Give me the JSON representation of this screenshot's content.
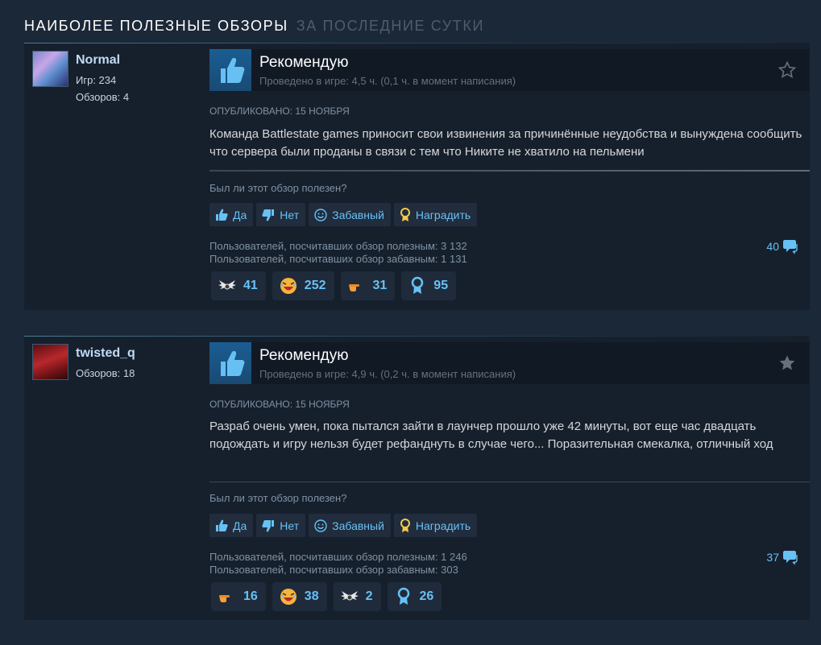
{
  "header": {
    "title": "Наиболее полезные обзоры",
    "subtitle": "за последние сутки"
  },
  "reviews": [
    {
      "author": {
        "name": "Normal",
        "games": "Игр: 234",
        "reviews": "Обзоров: 4"
      },
      "recommendation": "Рекомендую",
      "hours": "Проведено в игре: 4,5 ч. (0,1 ч. в момент написания)",
      "posted": "Опубликовано: 15 ноября",
      "text": "Команда Battlestate games приносит свои извинения за причинённые неудобства и вынуждена сообщить что сервера были проданы в связи с тем что Никите не хватило на пельмени",
      "question": "Был ли этот обзор полезен?",
      "buttons": {
        "yes": "Да",
        "no": "Нет",
        "funny": "Забавный",
        "award": "Наградить"
      },
      "helpful": "Пользователей, посчитавших обзор полезным: 3 132",
      "funny": "Пользователей, посчитавших обзор забавным: 1 131",
      "comments": "40",
      "awards": [
        {
          "icon": "wings-icon",
          "count": "41"
        },
        {
          "icon": "laughing-face-icon",
          "count": "252"
        },
        {
          "icon": "pointing-hand-icon",
          "count": "31"
        },
        {
          "icon": "medal-icon",
          "count": "95"
        }
      ]
    },
    {
      "author": {
        "name": "twisted_q",
        "reviews": "Обзоров: 18"
      },
      "recommendation": "Рекомендую",
      "hours": "Проведено в игре: 4,9 ч. (0,2 ч. в момент написания)",
      "posted": "Опубликовано: 15 ноября",
      "text": "Разраб очень умен, пока пытался зайти в лаунчер прошло уже 42 минуты, вот еще час двадцать подождать и игру нельзя будет рефанднуть в случае чего... Поразительная смекалка, отличный ход",
      "question": "Был ли этот обзор полезен?",
      "buttons": {
        "yes": "Да",
        "no": "Нет",
        "funny": "Забавный",
        "award": "Наградить"
      },
      "helpful": "Пользователей, посчитавших обзор полезным: 1 246",
      "funny": "Пользователей, посчитавших обзор забавным: 303",
      "comments": "37",
      "awards": [
        {
          "icon": "pointing-hand-icon",
          "count": "16"
        },
        {
          "icon": "laughing-face-icon",
          "count": "38"
        },
        {
          "icon": "wings-icon",
          "count": "2"
        },
        {
          "icon": "medal-icon",
          "count": "26"
        }
      ]
    }
  ]
}
